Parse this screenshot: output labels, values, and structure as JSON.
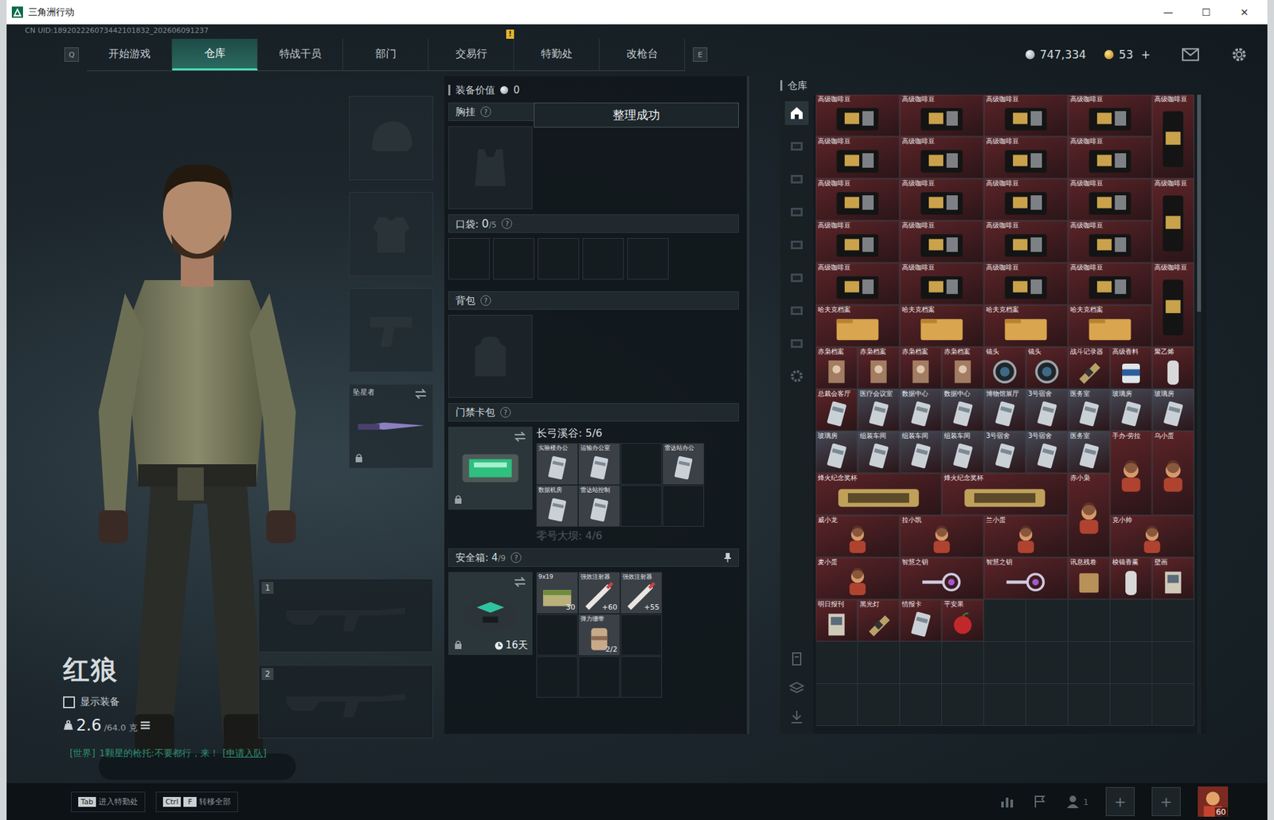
{
  "window": {
    "title": "三角洲行动",
    "controls": [
      "—",
      "☐",
      "✕"
    ]
  },
  "uid": "CN UID:189202226073442101832_202606091237",
  "nav": {
    "prev_key": "Q",
    "next_key": "E",
    "alert": "!",
    "tabs": [
      {
        "label": "开始游戏",
        "selected": false
      },
      {
        "label": "仓库",
        "selected": true
      },
      {
        "label": "特战干员",
        "selected": false
      },
      {
        "label": "部门",
        "selected": false
      },
      {
        "label": "交易行",
        "selected": false
      },
      {
        "label": "特勤处",
        "selected": false
      },
      {
        "label": "改枪台",
        "selected": false
      }
    ],
    "coins": {
      "amount": "747,334"
    },
    "bonds": {
      "amount": "53",
      "plus": "+"
    }
  },
  "operator": {
    "name": "红狼",
    "show_equipment": {
      "label": "显示装备",
      "checked": false
    },
    "weight": {
      "value": "2.6",
      "max": "/64.0",
      "unit": "克"
    },
    "chat": {
      "channel": "[世界]",
      "text": "1颗星的枪托:不要都行，来！",
      "action": "[申请入队]"
    }
  },
  "equipment": {
    "slots": [
      {
        "kind": "helmet",
        "label": "",
        "locked": false
      },
      {
        "kind": "armor",
        "label": "",
        "locked": false
      },
      {
        "kind": "pistol",
        "label": "",
        "locked": false
      },
      {
        "kind": "melee",
        "label": "坠星者",
        "locked": true
      }
    ],
    "weapons": [
      {
        "index": "1"
      },
      {
        "index": "2"
      }
    ]
  },
  "loadout": {
    "value_label": "装备价值",
    "value": "0",
    "toast": "整理成功",
    "help": "?",
    "chest": {
      "label": "胸挂"
    },
    "pocket": {
      "label": "口袋:",
      "count": "0",
      "capacity": "/5",
      "slots": 5
    },
    "backpack": {
      "label": "背包"
    },
    "keycard": {
      "label": "门禁卡包",
      "locked": true,
      "regions": [
        {
          "title": "长弓溪谷: 5/6",
          "faded": false,
          "cards": [
            {
              "label": "实验楼办公",
              "empty": false
            },
            {
              "label": "运输办公室",
              "empty": false
            },
            {
              "label": "",
              "empty": true
            },
            {
              "label": "雷达站办公",
              "empty": false
            },
            {
              "label": "数据机房",
              "empty": false
            },
            {
              "label": "雷达站控制",
              "empty": false
            },
            {
              "label": "",
              "empty": true
            },
            {
              "label": "",
              "empty": true
            }
          ]
        },
        {
          "title": "零号大坝: 4/6",
          "faded": true,
          "cards": []
        }
      ]
    },
    "safe": {
      "label": "安全箱:",
      "count": "4",
      "capacity": "/9",
      "timer": "16天",
      "locked": true,
      "items": [
        {
          "label": "9x19",
          "amount": "30",
          "kind": "ammo",
          "empty": false
        },
        {
          "label": "强效注射器",
          "amount": "+60",
          "kind": "syringe",
          "empty": false
        },
        {
          "label": "强效注射器",
          "amount": "+55",
          "kind": "syringe",
          "empty": false
        },
        {
          "label": "",
          "amount": "",
          "kind": "none",
          "empty": true
        },
        {
          "label": "弹力绷带",
          "amount": "2/2",
          "kind": "bandage",
          "empty": false
        },
        {
          "label": "",
          "amount": "",
          "kind": "none",
          "empty": true
        },
        {
          "label": "",
          "amount": "",
          "kind": "none",
          "empty": true
        },
        {
          "label": "",
          "amount": "",
          "kind": "none",
          "empty": true
        },
        {
          "label": "",
          "amount": "",
          "kind": "none",
          "empty": true
        }
      ]
    }
  },
  "warehouse": {
    "title": "仓库",
    "tabs": [
      {
        "selected": true
      },
      {
        "selected": false
      },
      {
        "selected": false
      },
      {
        "selected": false
      },
      {
        "selected": false
      },
      {
        "selected": false
      },
      {
        "selected": false
      },
      {
        "selected": false
      },
      {
        "selected": false
      }
    ],
    "items": [
      {
        "label": "高级咖啡豆",
        "kind": "coffee",
        "cells": "2x1",
        "color": "#5c2428"
      },
      {
        "label": "高级咖啡豆",
        "kind": "coffee",
        "cells": "2x1",
        "color": "#5c2428"
      },
      {
        "label": "高级咖啡豆",
        "kind": "coffee",
        "cells": "2x1",
        "color": "#5c2428"
      },
      {
        "label": "高级咖啡豆",
        "kind": "coffee",
        "cells": "2x1",
        "color": "#5c2428"
      },
      {
        "label": "高级咖啡豆",
        "kind": "coffee",
        "cells": "1x2",
        "color": "#5c2428"
      },
      {
        "label": "高级咖啡豆",
        "kind": "coffee",
        "cells": "2x1",
        "color": "#5c2428"
      },
      {
        "label": "高级咖啡豆",
        "kind": "coffee",
        "cells": "2x1",
        "color": "#5c2428"
      },
      {
        "label": "高级咖啡豆",
        "kind": "coffee",
        "cells": "2x1",
        "color": "#5c2428"
      },
      {
        "label": "高级咖啡豆",
        "kind": "coffee",
        "cells": "2x1",
        "color": "#5c2428"
      },
      {
        "label": "高级咖啡豆",
        "kind": "coffee",
        "cells": "2x1",
        "color": "#5c2428"
      },
      {
        "label": "高级咖啡豆",
        "kind": "coffee",
        "cells": "2x1",
        "color": "#5c2428"
      },
      {
        "label": "高级咖啡豆",
        "kind": "coffee",
        "cells": "2x1",
        "color": "#5c2428"
      },
      {
        "label": "高级咖啡豆",
        "kind": "coffee",
        "cells": "2x1",
        "color": "#5c2428"
      },
      {
        "label": "高级咖啡豆",
        "kind": "coffee",
        "cells": "1x2",
        "color": "#5c2428"
      },
      {
        "label": "高级咖啡豆",
        "kind": "coffee",
        "cells": "2x1",
        "color": "#5c2428"
      },
      {
        "label": "高级咖啡豆",
        "kind": "coffee",
        "cells": "2x1",
        "color": "#5c2428"
      },
      {
        "label": "高级咖啡豆",
        "kind": "coffee",
        "cells": "2x1",
        "color": "#5c2428"
      },
      {
        "label": "高级咖啡豆",
        "kind": "coffee",
        "cells": "2x1",
        "color": "#5c2428"
      },
      {
        "label": "高级咖啡豆",
        "kind": "coffee",
        "cells": "2x1",
        "color": "#5c2428"
      },
      {
        "label": "高级咖啡豆",
        "kind": "coffee",
        "cells": "2x1",
        "color": "#5c2428"
      },
      {
        "label": "高级咖啡豆",
        "kind": "coffee",
        "cells": "2x1",
        "color": "#5c2428"
      },
      {
        "label": "高级咖啡豆",
        "kind": "coffee",
        "cells": "2x1",
        "color": "#5c2428"
      },
      {
        "label": "高级咖啡豆",
        "kind": "coffee",
        "cells": "1x2",
        "color": "#5c2428"
      },
      {
        "label": "哈夫克档案",
        "kind": "file",
        "cells": "2x1",
        "color": "#5c2428"
      },
      {
        "label": "哈夫克档案",
        "kind": "file",
        "cells": "2x1",
        "color": "#5c2428"
      },
      {
        "label": "哈夫克档案",
        "kind": "file",
        "cells": "2x1",
        "color": "#5c2428"
      },
      {
        "label": "哈夫克档案",
        "kind": "file",
        "cells": "2x1",
        "color": "#5c2428"
      },
      {
        "label": "赤枭档案",
        "kind": "dossier",
        "cells": "1x1",
        "color": "#5c2428"
      },
      {
        "label": "赤枭档案",
        "kind": "dossier",
        "cells": "1x1",
        "color": "#5c2428"
      },
      {
        "label": "赤枭档案",
        "kind": "dossier",
        "cells": "1x1",
        "color": "#5c2428"
      },
      {
        "label": "赤枭档案",
        "kind": "dossier",
        "cells": "1x1",
        "color": "#5c2428"
      },
      {
        "label": "镜头",
        "kind": "lens",
        "cells": "1x1",
        "color": "#5c2428"
      },
      {
        "label": "镜头",
        "kind": "lens",
        "cells": "1x1",
        "color": "#5c2428"
      },
      {
        "label": "战斗记录器",
        "kind": "recorder",
        "cells": "1x1",
        "color": "#5c2428"
      },
      {
        "label": "高级香料",
        "kind": "can",
        "cells": "1x1",
        "color": "#5c2428"
      },
      {
        "label": "聚乙烯",
        "kind": "cylinder",
        "cells": "1x1",
        "color": "#5c2428"
      },
      {
        "label": "总裁会客厅",
        "kind": "card",
        "cells": "1x1",
        "color": "#5c2428"
      },
      {
        "label": "医疗会议室",
        "kind": "card",
        "cells": "1x1",
        "color": "#454a57"
      },
      {
        "label": "数据中心",
        "kind": "card",
        "cells": "1x1",
        "color": "#454a57"
      },
      {
        "label": "数据中心",
        "kind": "card",
        "cells": "1x1",
        "color": "#454a57"
      },
      {
        "label": "博物馆展厅",
        "kind": "card",
        "cells": "1x1",
        "color": "#454a57"
      },
      {
        "label": "3号宿舍",
        "kind": "card",
        "cells": "1x1",
        "color": "#454a57"
      },
      {
        "label": "医务室",
        "kind": "card",
        "cells": "1x1",
        "color": "#454a57"
      },
      {
        "label": "玻璃房",
        "kind": "card",
        "cells": "1x1",
        "color": "#454a57"
      },
      {
        "label": "玻璃房",
        "kind": "card",
        "cells": "1x1",
        "color": "#454a57"
      },
      {
        "label": "玻璃房",
        "kind": "card",
        "cells": "1x1",
        "color": "#454a57"
      },
      {
        "label": "组装车间",
        "kind": "card",
        "cells": "1x1",
        "color": "#454a57"
      },
      {
        "label": "组装车间",
        "kind": "card",
        "cells": "1x1",
        "color": "#454a57"
      },
      {
        "label": "组装车间",
        "kind": "card",
        "cells": "1x1",
        "color": "#454a57"
      },
      {
        "label": "3号宿舍",
        "kind": "card",
        "cells": "1x1",
        "color": "#454a57"
      },
      {
        "label": "3号宿舍",
        "kind": "card",
        "cells": "1x1",
        "color": "#454a57"
      },
      {
        "label": "医务室",
        "kind": "card",
        "cells": "1x1",
        "color": "#454a57"
      },
      {
        "label": "手办·劳拉",
        "kind": "figure",
        "cells": "1x2",
        "color": "#5c2428"
      },
      {
        "label": "乌小蛋",
        "kind": "figure",
        "cells": "1x2",
        "color": "#5c2428"
      },
      {
        "label": "烽火纪念奖杯",
        "kind": "trophy",
        "cells": "3x1",
        "color": "#5c2428"
      },
      {
        "label": "烽火纪念奖杯",
        "kind": "trophy",
        "cells": "3x1",
        "color": "#5c2428"
      },
      {
        "label": "赤小枭",
        "kind": "figure",
        "cells": "1x2",
        "color": "#5c2428"
      },
      {
        "label": "威小龙",
        "kind": "figure",
        "cells": "2x1",
        "color": "#5c2428"
      },
      {
        "label": "拉小凯",
        "kind": "figure",
        "cells": "2x1",
        "color": "#5c2428"
      },
      {
        "label": "兰小蛋",
        "kind": "figure",
        "cells": "2x1",
        "color": "#5c2428"
      },
      {
        "label": "克小帅",
        "kind": "figure",
        "cells": "2x1",
        "color": "#5c2428"
      },
      {
        "label": "麦小蛋",
        "kind": "figure",
        "cells": "2x1",
        "color": "#5c2428"
      },
      {
        "label": "智慧之钥",
        "kind": "key",
        "cells": "2x1",
        "color": "#5c2428"
      },
      {
        "label": "智慧之钥",
        "kind": "key",
        "cells": "2x1",
        "color": "#5c2428"
      },
      {
        "label": "讯息残卷",
        "kind": "scroll",
        "cells": "1x1",
        "color": "#5c2428"
      },
      {
        "label": "棱镜香薰",
        "kind": "cylinder",
        "cells": "1x1",
        "color": "#5c2428"
      },
      {
        "label": "壁画",
        "kind": "paper",
        "cells": "1x1",
        "color": "#5c2428"
      },
      {
        "label": "明日报刊",
        "kind": "paper",
        "cells": "1x1",
        "color": "#5c2428"
      },
      {
        "label": "黑光灯",
        "kind": "recorder",
        "cells": "1x1",
        "color": "#5c2428"
      },
      {
        "label": "情报卡",
        "kind": "card",
        "cells": "1x1",
        "color": "#5c2428"
      },
      {
        "label": "平安果",
        "kind": "apple",
        "cells": "1x1",
        "color": "#5c2428"
      }
    ]
  },
  "bottom": {
    "hints": [
      {
        "keys": [
          "Tab"
        ],
        "label": "进入特勤处"
      },
      {
        "keys": [
          "Ctrl",
          "F"
        ],
        "label": "转移全部"
      }
    ],
    "squad": "1",
    "slots": [
      "+",
      "+"
    ],
    "level": "60"
  }
}
